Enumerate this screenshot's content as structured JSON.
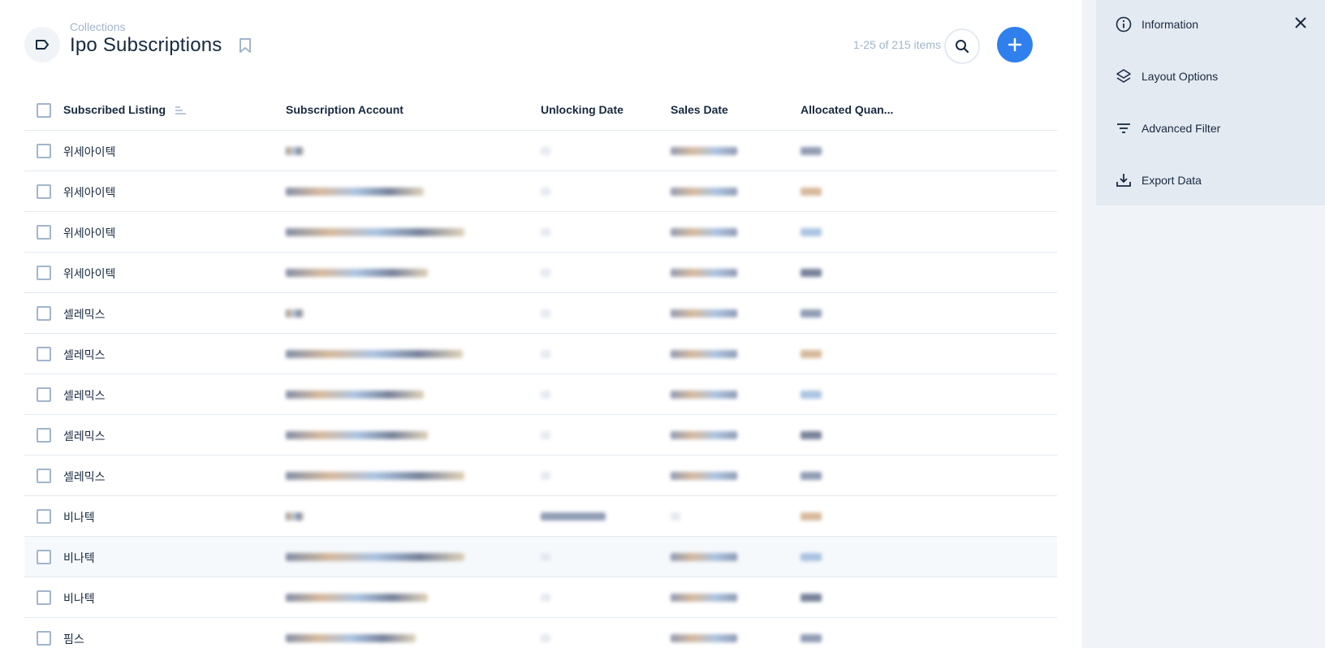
{
  "header": {
    "breadcrumb": "Collections",
    "title": "Ipo Subscriptions",
    "item_count": "1-25 of 215 items"
  },
  "table": {
    "columns": [
      "Subscribed Listing",
      "Subscription Account",
      "Unlocking Date",
      "Sales Date",
      "Allocated Quan..."
    ],
    "rows": [
      {
        "listing": "위세아이텍"
      },
      {
        "listing": "위세아이텍"
      },
      {
        "listing": "위세아이텍"
      },
      {
        "listing": "위세아이텍"
      },
      {
        "listing": "셀레믹스"
      },
      {
        "listing": "셀레믹스"
      },
      {
        "listing": "셀레믹스"
      },
      {
        "listing": "셀레믹스"
      },
      {
        "listing": "셀레믹스"
      },
      {
        "listing": "비나텍"
      },
      {
        "listing": "비나텍"
      },
      {
        "listing": "비나텍"
      },
      {
        "listing": "핌스"
      }
    ]
  },
  "sidebar": {
    "items": [
      {
        "label": "Information",
        "icon": "info-icon"
      },
      {
        "label": "Layout Options",
        "icon": "layers-icon"
      },
      {
        "label": "Advanced Filter",
        "icon": "filter-icon"
      },
      {
        "label": "Export Data",
        "icon": "download-icon"
      }
    ]
  },
  "colors": {
    "accent": "#2f80ed",
    "text": "#172940",
    "muted": "#a2b5cd",
    "sidebar_bg": "#f0f4f9",
    "sidebar_panel": "#e4eaf1"
  }
}
